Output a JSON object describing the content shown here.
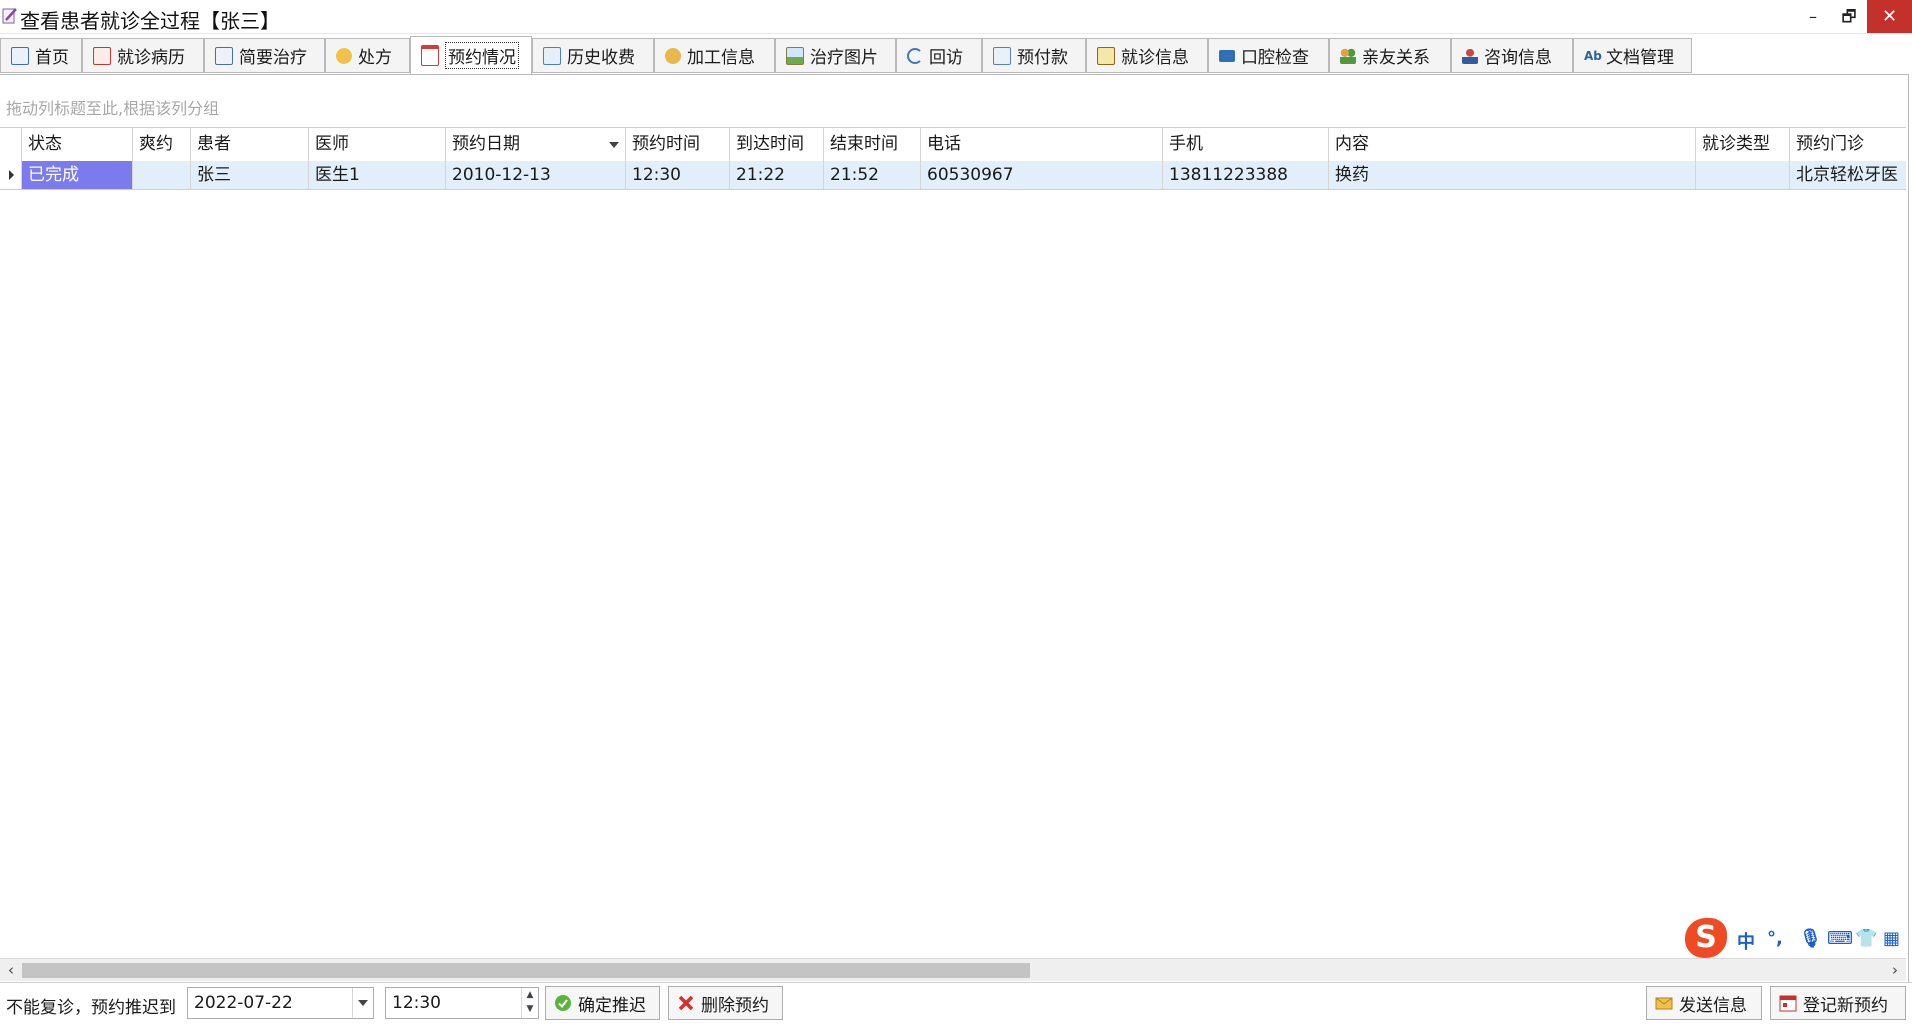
{
  "window": {
    "title": "查看患者就诊全过程【张三】"
  },
  "tabs": [
    {
      "label": "首页",
      "icon": "home-doc-icon",
      "color": "#3a6fb7"
    },
    {
      "label": "就诊病历",
      "icon": "medical-record-icon",
      "color": "#c0392b"
    },
    {
      "label": "简要治疗",
      "icon": "notes-icon",
      "color": "#4a6fa5"
    },
    {
      "label": "处方",
      "icon": "pill-icon",
      "color": "#e0a020"
    },
    {
      "label": "预约情况",
      "icon": "calendar-icon",
      "color": "#d23b3b"
    },
    {
      "label": "历史收费",
      "icon": "billing-icon",
      "color": "#4e7fbd"
    },
    {
      "label": "加工信息",
      "icon": "process-icon",
      "color": "#d8a42a"
    },
    {
      "label": "治疗图片",
      "icon": "picture-icon",
      "color": "#5a9a3a"
    },
    {
      "label": "回访",
      "icon": "refresh-icon",
      "color": "#3a7ac0"
    },
    {
      "label": "预付款",
      "icon": "prepay-icon",
      "color": "#5c7fb0"
    },
    {
      "label": "就诊信息",
      "icon": "clipboard-icon",
      "color": "#c9a227"
    },
    {
      "label": "口腔检查",
      "icon": "briefcase-icon",
      "color": "#2f6fb5"
    },
    {
      "label": "亲友关系",
      "icon": "people-icon",
      "color": "#4f9a3e"
    },
    {
      "label": "咨询信息",
      "icon": "consult-icon",
      "color": "#c94a3a"
    },
    {
      "label": "文档管理",
      "icon": "spellcheck-icon",
      "color": "#2f5f9f"
    }
  ],
  "active_tab": "预约情况",
  "group_panel": {
    "hint": "拖动列标题至此,根据该列分组"
  },
  "grid": {
    "columns": [
      "状态",
      "爽约",
      "患者",
      "医师",
      "预约日期",
      "预约时间",
      "到达时间",
      "结束时间",
      "电话",
      "手机",
      "内容",
      "就诊类型",
      "预约门诊"
    ],
    "rows": [
      [
        "已完成",
        "",
        "张三",
        "医生1",
        "2010-12-13",
        "12:30",
        "21:22",
        "21:52",
        "60530967",
        "13811223388",
        "换药",
        "",
        "北京轻松牙医"
      ]
    ]
  },
  "ime_toolbar": {
    "logo": "S",
    "mode": "中",
    "punct": "°,",
    "items": [
      "mic-icon",
      "keyboard-icon",
      "skin-icon",
      "grid-icon"
    ]
  },
  "bottom": {
    "label": "不能复诊，预约推迟到",
    "date_value": "2022-07-22",
    "time_value": "12:30",
    "confirm_button": "确定推迟",
    "delete_button": "删除预约",
    "send_button": "发送信息",
    "register_button": "登记新预约"
  }
}
